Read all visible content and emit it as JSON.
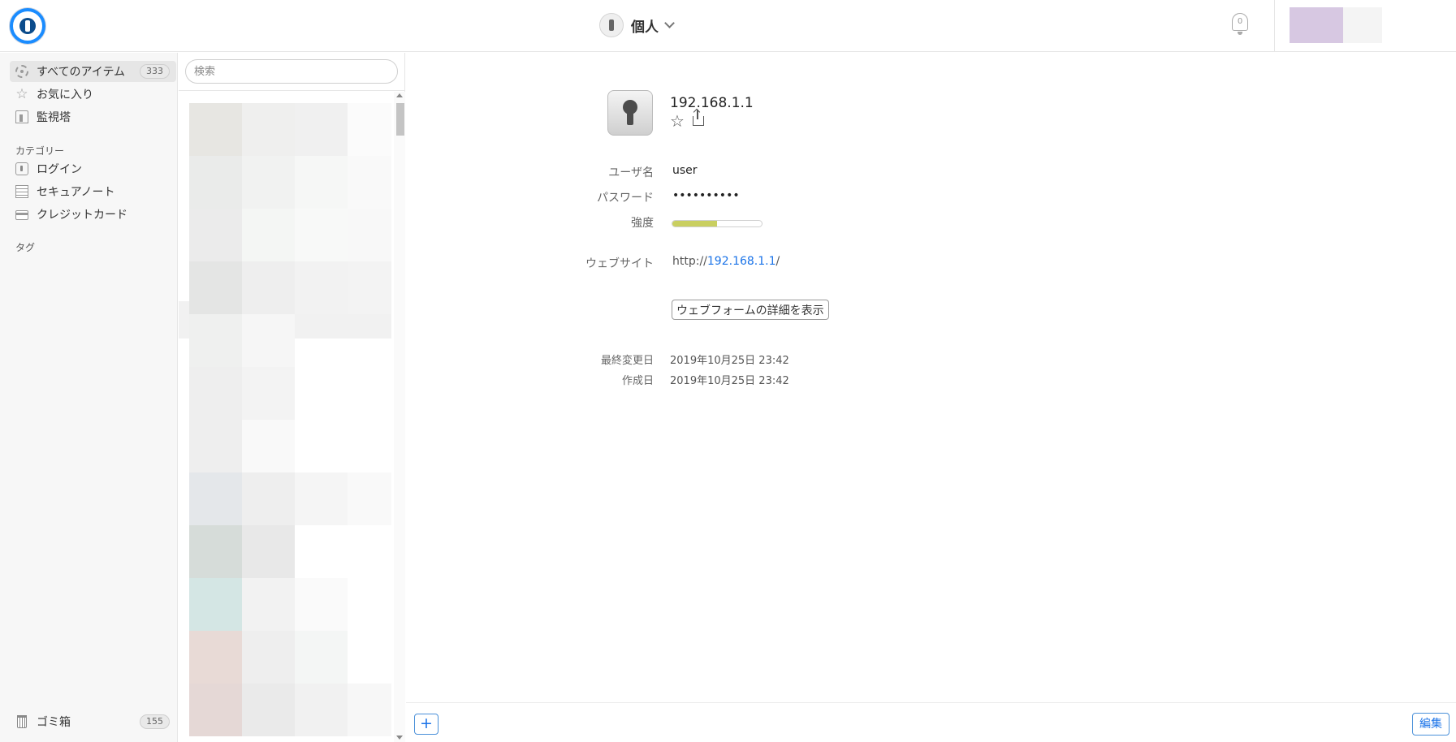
{
  "header": {
    "vault_name": "個人",
    "notification_count": "0",
    "accent_color": "#1a8cff"
  },
  "sidebar": {
    "all_items": {
      "label": "すべてのアイテム",
      "count": "333",
      "icon": "gear-icon"
    },
    "favorites": {
      "label": "お気に入り",
      "icon": "star-icon"
    },
    "watchtower": {
      "label": "監視塔",
      "icon": "tower-icon"
    },
    "categories_heading": "カテゴリー",
    "categories": [
      {
        "label": "ログイン",
        "icon": "login-icon"
      },
      {
        "label": "セキュアノート",
        "icon": "note-icon"
      },
      {
        "label": "クレジットカード",
        "icon": "credit-card-icon"
      }
    ],
    "tags_heading": "タグ",
    "trash": {
      "label": "ゴミ箱",
      "count": "155",
      "icon": "trash-icon"
    }
  },
  "list": {
    "search_placeholder": "検索"
  },
  "detail": {
    "title": "192.168.1.1",
    "fields": {
      "username_label": "ユーザ名",
      "username_value": "user",
      "password_label": "パスワード",
      "password_value": "••••••••••",
      "strength_label": "強度",
      "strength_fraction": 0.5,
      "strength_color": "#c9cf60",
      "website_label": "ウェブサイト",
      "website_prefix": "http://",
      "website_host": "192.168.1.1",
      "website_suffix": "/"
    },
    "webform_button": "ウェブフォームの詳細を表示",
    "modified_label": "最終変更日",
    "modified_value": "2019年10月25日 23:42",
    "created_label": "作成日",
    "created_value": "2019年10月25日 23:42",
    "add_button": "+",
    "edit_button": "編集"
  }
}
